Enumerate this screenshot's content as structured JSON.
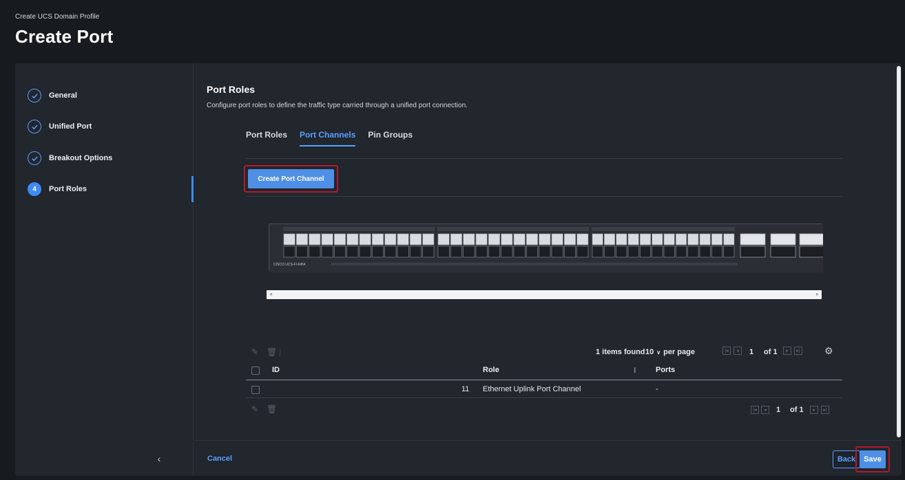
{
  "header": {
    "breadcrumb": "Create UCS Domain Profile",
    "title": "Create Port"
  },
  "sidebar": {
    "steps": [
      {
        "label": "General",
        "state": "done"
      },
      {
        "label": "Unified Port",
        "state": "done"
      },
      {
        "label": "Breakout Options",
        "state": "done"
      },
      {
        "label": "Port Roles",
        "state": "active",
        "number": "4"
      }
    ],
    "collapse_glyph": "‹"
  },
  "main": {
    "section_title": "Port Roles",
    "section_description": "Configure port roles to define the traffic type carried through a unified port connection.",
    "tabs": [
      {
        "label": "Port Roles",
        "active": false
      },
      {
        "label": "Port Channels",
        "active": true
      },
      {
        "label": "Pin Groups",
        "active": false
      }
    ],
    "create_button_label": "Create Port Channel",
    "switch_model_label": "CISCO UCS-FI-6454"
  },
  "table": {
    "items_found": "1 items found",
    "per_page_value": "10",
    "per_page_label": "per page",
    "page_current": "1",
    "page_total": "of 1",
    "columns": [
      "ID",
      "Role",
      "Ports"
    ],
    "rows": [
      {
        "id": "11",
        "role": "Ethernet Uplink Port Channel",
        "ports": "-"
      }
    ]
  },
  "footer": {
    "cancel_label": "Cancel",
    "back_label": "Back",
    "save_label": "Save"
  },
  "colors": {
    "accent": "#58a0ff",
    "highlight_border": "#b11b2c",
    "panel": "#22262d",
    "background": "#171a1f"
  }
}
